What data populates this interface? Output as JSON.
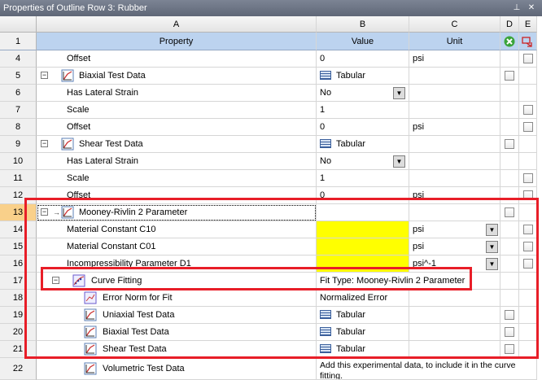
{
  "window": {
    "title": "Properties of Outline Row 3: Rubber",
    "pin_icon": "pin-icon",
    "close_icon": "close-icon"
  },
  "columns": {
    "letters": [
      "A",
      "B",
      "C",
      "D",
      "E"
    ],
    "names": {
      "property": "Property",
      "value": "Value",
      "unit": "Unit"
    },
    "header_row_number": "1"
  },
  "rows": [
    {
      "n": "4",
      "label": "Offset",
      "value": "0",
      "unit": "psi"
    },
    {
      "n": "5",
      "label": "Biaxial Test Data",
      "value": "Tabular"
    },
    {
      "n": "6",
      "label": "Has Lateral Strain",
      "value": "No"
    },
    {
      "n": "7",
      "label": "Scale",
      "value": "1"
    },
    {
      "n": "8",
      "label": "Offset",
      "value": "0",
      "unit": "psi"
    },
    {
      "n": "9",
      "label": "Shear Test Data",
      "value": "Tabular"
    },
    {
      "n": "10",
      "label": "Has Lateral Strain",
      "value": "No"
    },
    {
      "n": "11",
      "label": "Scale",
      "value": "1"
    },
    {
      "n": "12",
      "label": "Offset",
      "value": "0",
      "unit": "psi"
    },
    {
      "n": "13",
      "label": "Mooney-Rivlin 2 Parameter"
    },
    {
      "n": "14",
      "label": "Material Constant C10",
      "unit": "psi"
    },
    {
      "n": "15",
      "label": "Material Constant C01",
      "unit": "psi"
    },
    {
      "n": "16",
      "label": "Incompressibility Parameter D1",
      "unit": "psi^-1"
    },
    {
      "n": "17",
      "label": "Curve Fitting",
      "value": "Fit Type: Mooney-Rivlin 2 Parameter"
    },
    {
      "n": "18",
      "label": "Error Norm for Fit",
      "value": "Normalized Error"
    },
    {
      "n": "19",
      "label": "Uniaxial Test Data",
      "value": "Tabular"
    },
    {
      "n": "20",
      "label": "Biaxial Test Data",
      "value": "Tabular"
    },
    {
      "n": "21",
      "label": "Shear Test Data",
      "value": "Tabular"
    },
    {
      "n": "22",
      "label": "Volumetric Test Data",
      "value": "Add this experimental data, to include it in the curve fitting."
    }
  ],
  "colors": {
    "highlight_box": "#e81e28",
    "yellow_input": "#ffff00",
    "header_blue": "#bcd3ef",
    "selected_row_number": "#f9d08a"
  }
}
